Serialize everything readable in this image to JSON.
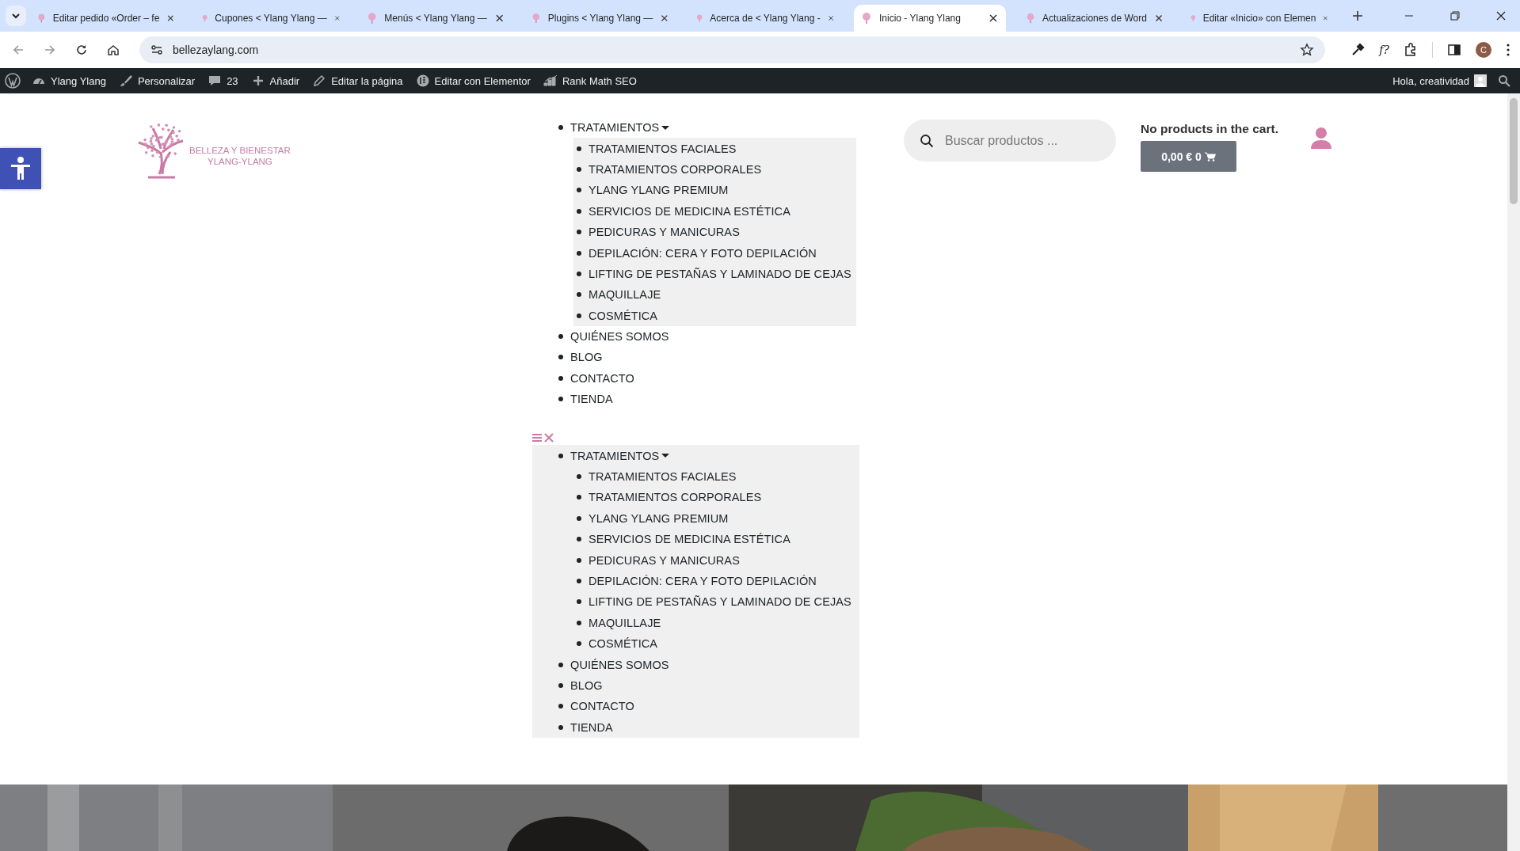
{
  "browser": {
    "tabs": [
      {
        "title": "Editar pedido «Order – fe",
        "selected": false
      },
      {
        "title": "Cupones < Ylang Ylang —",
        "selected": false
      },
      {
        "title": "Menús < Ylang Ylang —",
        "selected": false
      },
      {
        "title": "Plugins < Ylang Ylang —",
        "selected": false
      },
      {
        "title": "Acerca de < Ylang Ylang -",
        "selected": false
      },
      {
        "title": "Inicio - Ylang Ylang",
        "selected": true
      },
      {
        "title": "Actualizaciones de Word",
        "selected": false
      },
      {
        "title": "Editar «Inicio» con Elemen",
        "selected": false
      }
    ],
    "url": "bellezaylang.com",
    "extension_label": "f?",
    "profile_initial": "C"
  },
  "admin_bar": {
    "items": [
      {
        "kind": "site",
        "label": "Ylang Ylang"
      },
      {
        "kind": "customize",
        "label": "Personalizar"
      },
      {
        "kind": "comments",
        "label": "23"
      },
      {
        "kind": "new",
        "label": "Añadir"
      },
      {
        "kind": "edit",
        "label": "Editar la página"
      },
      {
        "kind": "elementor",
        "label": "Editar con Elementor"
      },
      {
        "kind": "rankmath",
        "label": "Rank Math SEO"
      }
    ],
    "greeting": "Hola, creatividad"
  },
  "logo": {
    "line_1": "BELLEZA Y BIENESTAR",
    "line_2": "YLANG-YLANG"
  },
  "menus": [
    {
      "toggle": false,
      "items": [
        {
          "label": "TRATAMIENTOS",
          "expanded": true,
          "children": [
            {
              "label": "TRATAMIENTOS FACIALES"
            },
            {
              "label": "TRATAMIENTOS CORPORALES"
            },
            {
              "label": "YLANG YLANG PREMIUM"
            },
            {
              "label": "SERVICIOS DE MEDICINA ESTÉTICA"
            },
            {
              "label": "PEDICURAS Y MANICURAS"
            },
            {
              "label": "DEPILACIÓN: CERA Y FOTO DEPILACIÓN"
            },
            {
              "label": "LIFTING DE PESTAÑAS Y LAMINADO DE CEJAS"
            },
            {
              "label": "MAQUILLAJE"
            },
            {
              "label": "COSMÉTICA"
            }
          ]
        },
        {
          "label": "QUIÉNES SOMOS"
        },
        {
          "label": "BLOG"
        },
        {
          "label": "CONTACTO"
        },
        {
          "label": "TIENDA"
        }
      ]
    },
    {
      "toggle": true,
      "items": [
        {
          "label": "TRATAMIENTOS",
          "expanded": true,
          "children": [
            {
              "label": "TRATAMIENTOS FACIALES"
            },
            {
              "label": "TRATAMIENTOS CORPORALES"
            },
            {
              "label": "YLANG YLANG PREMIUM"
            },
            {
              "label": "SERVICIOS DE MEDICINA ESTÉTICA"
            },
            {
              "label": "PEDICURAS Y MANICURAS"
            },
            {
              "label": "DEPILACIÓN: CERA Y FOTO DEPILACIÓN"
            },
            {
              "label": "LIFTING DE PESTAÑAS Y LAMINADO DE CEJAS"
            },
            {
              "label": "MAQUILLAJE"
            },
            {
              "label": "COSMÉTICA"
            }
          ]
        },
        {
          "label": "QUIÉNES SOMOS"
        },
        {
          "label": "BLOG"
        },
        {
          "label": "CONTACTO"
        },
        {
          "label": "TIENDA"
        }
      ]
    }
  ],
  "search": {
    "placeholder": "Buscar productos ..."
  },
  "cart": {
    "message": "No products in the cart.",
    "total": "0,00 € 0"
  }
}
